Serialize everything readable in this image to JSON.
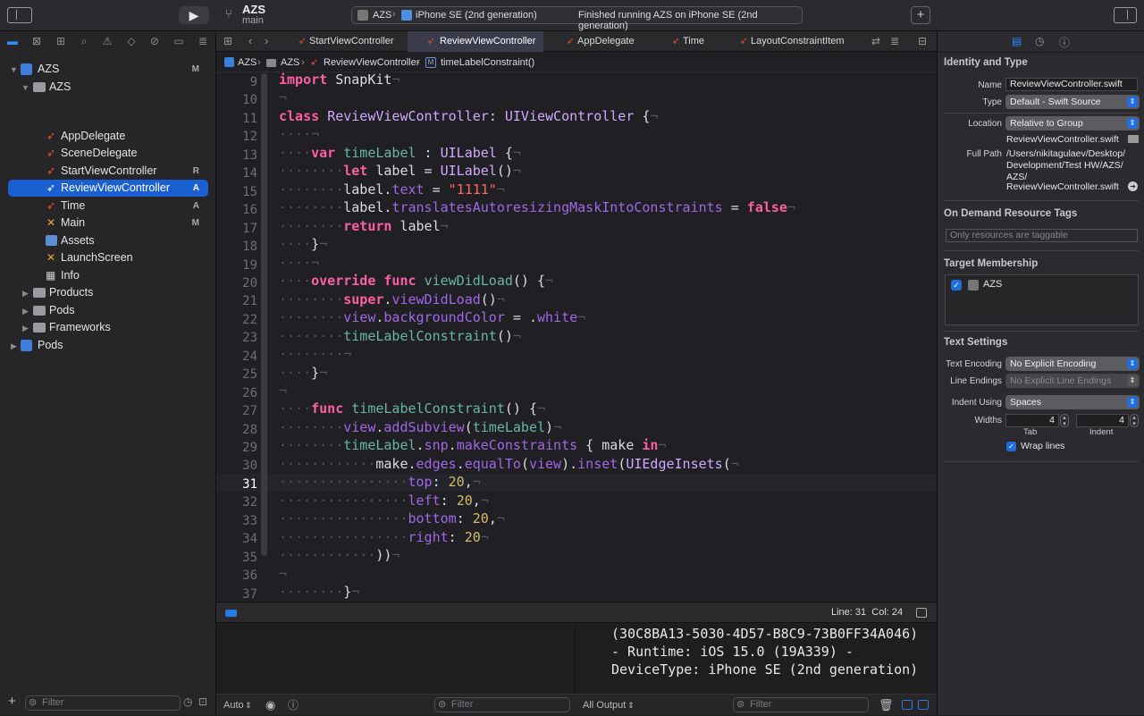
{
  "toolbar": {
    "project_name": "AZS",
    "branch": "main",
    "scheme": "AZS",
    "device": "iPhone SE (2nd generation)",
    "status": "Finished running AZS on iPhone SE (2nd generation)"
  },
  "navigator": {
    "items": [
      {
        "label": "AZS",
        "badge": "M"
      },
      {
        "label": "AZS",
        "badge": ""
      },
      {
        "label": "AppDelegate",
        "badge": ""
      },
      {
        "label": "SceneDelegate",
        "badge": ""
      },
      {
        "label": "StartViewController",
        "badge": "R"
      },
      {
        "label": "ReviewViewController",
        "badge": "A"
      },
      {
        "label": "Time",
        "badge": "A"
      },
      {
        "label": "Main",
        "badge": "M"
      },
      {
        "label": "Assets",
        "badge": ""
      },
      {
        "label": "LaunchScreen",
        "badge": ""
      },
      {
        "label": "Info",
        "badge": ""
      },
      {
        "label": "Products",
        "badge": ""
      },
      {
        "label": "Pods",
        "badge": ""
      },
      {
        "label": "Frameworks",
        "badge": ""
      },
      {
        "label": "Pods",
        "badge": ""
      }
    ],
    "filter_placeholder": "Filter"
  },
  "tabs": [
    "StartViewController",
    "ReviewViewController",
    "AppDelegate",
    "Time",
    "LayoutConstraintItem"
  ],
  "breadcrumb": [
    "AZS",
    "AZS",
    "ReviewViewController",
    "timeLabelConstraint()"
  ],
  "code": {
    "line_numbers": [
      "9",
      "10",
      "11",
      "12",
      "13",
      "14",
      "15",
      "16",
      "17",
      "18",
      "19",
      "20",
      "21",
      "22",
      "23",
      "24",
      "25",
      "26",
      "27",
      "28",
      "29",
      "30",
      "31",
      "32",
      "33",
      "34",
      "35",
      "36",
      "37"
    ],
    "current_line": "31"
  },
  "status_bar": {
    "position": "Line: 31  Col: 24"
  },
  "debug": {
    "auto_label": "Auto",
    "filter_placeholder": "Filter",
    "output_label": "All Output",
    "console_lines": [
      "(30C8BA13-5030-4D57-B8C9-73B0FF34A046)",
      "- Runtime: iOS 15.0 (19A339) -",
      "DeviceType: iPhone SE (2nd generation)"
    ]
  },
  "inspector": {
    "identity_title": "Identity and Type",
    "name_label": "Name",
    "name_value": "ReviewViewController.swift",
    "type_label": "Type",
    "type_value": "Default - Swift Source",
    "location_label": "Location",
    "location_value": "Relative to Group",
    "location_file": "ReviewViewController.swift",
    "fullpath_label": "Full Path",
    "fullpath_lines": [
      "/Users/nikitagulaev/Desktop/",
      "Development/Test HW/AZS/",
      "AZS/",
      "ReviewViewController.swift"
    ],
    "odr_title": "On Demand Resource Tags",
    "odr_placeholder": "Only resources are taggable",
    "target_title": "Target Membership",
    "target_name": "AZS",
    "text_title": "Text Settings",
    "encoding_label": "Text Encoding",
    "encoding_value": "No Explicit Encoding",
    "endings_label": "Line Endings",
    "endings_value": "No Explicit Line Endings",
    "indent_label": "Indent Using",
    "indent_value": "Spaces",
    "widths_label": "Widths",
    "tab_value": "4",
    "indent_width_value": "4",
    "tab_caption": "Tab",
    "indent_caption": "Indent",
    "wrap_label": "Wrap lines"
  }
}
